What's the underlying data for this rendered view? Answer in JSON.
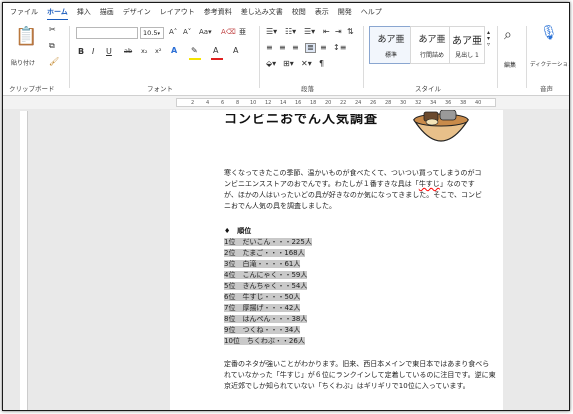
{
  "menu": {
    "tabs": [
      "ファイル",
      "ホーム",
      "挿入",
      "描画",
      "デザイン",
      "レイアウト",
      "参考資料",
      "差し込み文書",
      "校閲",
      "表示",
      "開発",
      "ヘルプ"
    ],
    "active": "ホーム"
  },
  "ribbon": {
    "clipboard": {
      "paste_label": "貼り付け",
      "group_label": "クリップボード"
    },
    "font": {
      "size": "10.5",
      "group_label": "フォント",
      "buttons": [
        "B",
        "I",
        "U",
        "ab",
        "x₂",
        "x²",
        "A",
        "A",
        "A"
      ]
    },
    "paragraph": {
      "group_label": "段落"
    },
    "styles": {
      "cards": [
        {
          "sample": "あア亜",
          "label": "標準"
        },
        {
          "sample": "あア亜",
          "label": "行間詰め"
        },
        {
          "sample": "あア亜",
          "label": "見出し 1"
        }
      ],
      "group_label": "スタイル"
    },
    "editing": {
      "label": "編集"
    },
    "voice": {
      "label": "ディクテーション",
      "group_label": "音声"
    }
  },
  "ruler": {
    "ticks": [
      "2",
      "4",
      "6",
      "8",
      "10",
      "12",
      "14",
      "16",
      "18",
      "20",
      "22",
      "24",
      "26",
      "28",
      "30",
      "32",
      "34",
      "36",
      "38",
      "40"
    ]
  },
  "document": {
    "title": "コンビニおでん人気調査",
    "para1_a": "寒くなってきたこの季節、温かいものが食べたくて、ついつい買ってしまうのがコンビニエンスストアのおでんです。わたしが１番すきな具は「",
    "para1_err": "牛すじ",
    "para1_b": "」なのですが、ほかの人はいったいどの具が好きなのか気になってきました。そこで、コンビニおでん人気の具を調査しました。",
    "rank_heading": "♦　順位",
    "ranks": [
      "1位　だいこん・・・225人",
      "2位　たまご・・・168人",
      "3位　白滝・・・・61人",
      "4位　こんにゃく・・59人",
      "5位　きんちゃく・・54人",
      "6位　牛すじ・・・50人",
      "7位　厚揚げ・・・42人",
      "8位　はんぺん・・・38人",
      "9位　つくね・・・34人",
      "10位　ちくわぶ・・26人"
    ],
    "para2": "定番のネタが強いことがわかります。旧来、西日本メインで東日本ではあまり食べられていなかった「牛すじ」が６位にランクインして定着しているのに注目です。逆に東京近郊でしか知られていない「ちくわぶ」はギリギリで10位に入っています。"
  }
}
